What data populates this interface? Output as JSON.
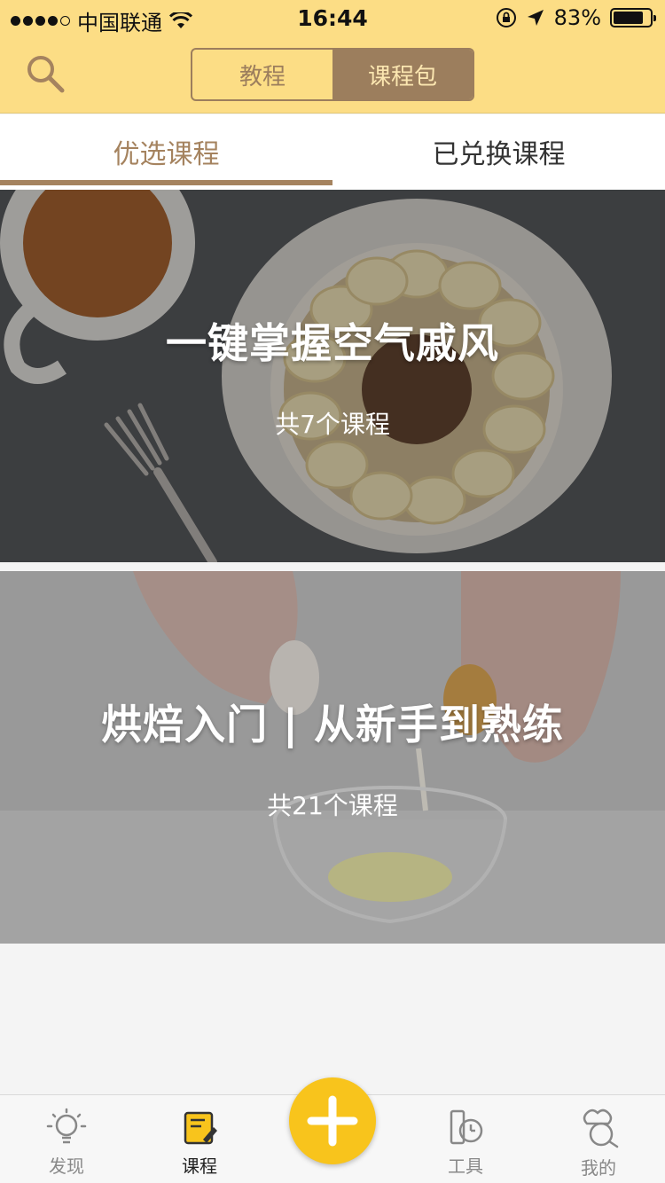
{
  "status_bar": {
    "carrier": "中国联通",
    "time": "16:44",
    "battery": "83%",
    "battery_level": 0.83
  },
  "navbar": {
    "segments": [
      {
        "label": "教程",
        "active": false
      },
      {
        "label": "课程包",
        "active": true
      }
    ]
  },
  "subtabs": [
    {
      "label": "优选课程",
      "active": true
    },
    {
      "label": "已兑换课程",
      "active": false
    }
  ],
  "courses": [
    {
      "title": "一键掌握空气戚风",
      "count": "共7个课程"
    },
    {
      "title": "烘焙入门 | 从新手到熟练",
      "count": "共21个课程"
    }
  ],
  "tabbar": {
    "items": [
      {
        "label": "发现",
        "icon": "lightbulb-icon"
      },
      {
        "label": "课程",
        "icon": "notebook-icon",
        "active": true
      },
      {
        "label": "工具",
        "icon": "timer-icon"
      },
      {
        "label": "我的",
        "icon": "chef-icon"
      }
    ],
    "center_icon": "plus-icon"
  },
  "colors": {
    "header_bg": "#fcdd85",
    "accent_brown": "#9c7e5d",
    "fab_yellow": "#f8c41c"
  }
}
